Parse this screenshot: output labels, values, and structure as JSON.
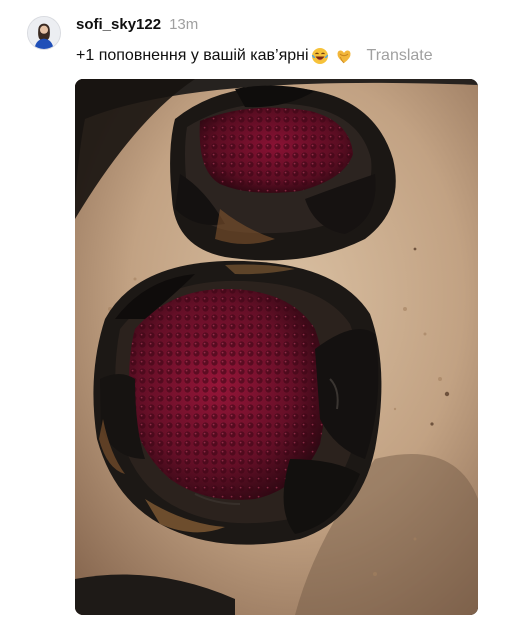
{
  "post": {
    "username": "sofi_sky122",
    "timestamp": "13m",
    "caption": "+1 поповнення у вашій кав’ярні",
    "caption_emojis": [
      "laughing-face-emoji",
      "heart-hands-emoji"
    ],
    "translate_label": "Translate"
  },
  "media": {
    "image_alt": "photo",
    "icon": "photo-of-burnt-berry-galettes"
  },
  "colors": {
    "text_primary": "#101010",
    "text_secondary": "#a0a0a0",
    "parchment": "#c9a98a",
    "berry": "#7a1030",
    "char": "#1b1714"
  }
}
